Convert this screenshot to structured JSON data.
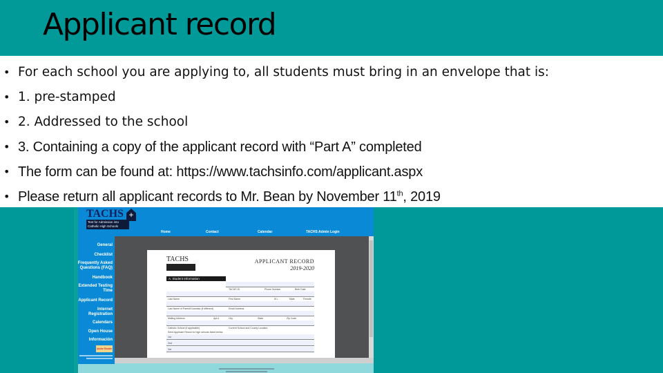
{
  "slide": {
    "title": "Applicant record",
    "bullets": [
      {
        "text": "For each school you are applying to, all students must bring in an envelope that is:"
      },
      {
        "text": "1. pre-stamped"
      },
      {
        "text": "2. Addressed to the school"
      },
      {
        "text": "3. Containing  a copy of the applicant record with “Part A” completed"
      },
      {
        "text": "The form can be found at: https://www.tachsinfo.com/applicant.aspx"
      },
      {
        "text_before": "Please return all applicant records to Mr. Bean by November 11",
        "superscript": "th",
        "text_after": ", 2019"
      }
    ],
    "bullet_glyph": "•"
  },
  "embedded_screenshot": {
    "logo": {
      "name": "TACHS",
      "subtitle": "Test for Admission into Catholic High Schools"
    },
    "top_nav": [
      "Home",
      "Contact",
      "Calendar",
      "TACHS Admin Login"
    ],
    "sidebar": [
      "General",
      "Checklist",
      "Frequently Asked Questions (FAQ)",
      "Handbook",
      "Extended Testing Time",
      "Applicant Record",
      "Internet Registration",
      "Calendars",
      "Open House",
      "Información"
    ],
    "reader_badge": "Adobe Reader",
    "document": {
      "logo": "TACHS",
      "title": "APPLICANT RECORD",
      "year": "2019-2020",
      "section": "A. Student Information",
      "field_labels": [
        "TACHS ID",
        "Phone Number",
        "Birth Date",
        "Last Name",
        "First Name",
        "M.I.",
        "Male",
        "Female",
        "Last Name of Parent/Guardian (if different)",
        "Email Address",
        "Mailing Address",
        "Apt.#",
        "City",
        "State",
        "Zip Code",
        "Catholic School (if applicable)",
        "Current School and County Location",
        "Send Applicant Record to high schools listed below:",
        "1st",
        "2nd",
        "3rd"
      ]
    },
    "colors": {
      "nav_blue": "#0a8ad6",
      "viewer_gray": "#505153",
      "footer_cyan": "#8fd9dc"
    }
  },
  "colors": {
    "background_teal": "#009999",
    "text": "#111111"
  }
}
